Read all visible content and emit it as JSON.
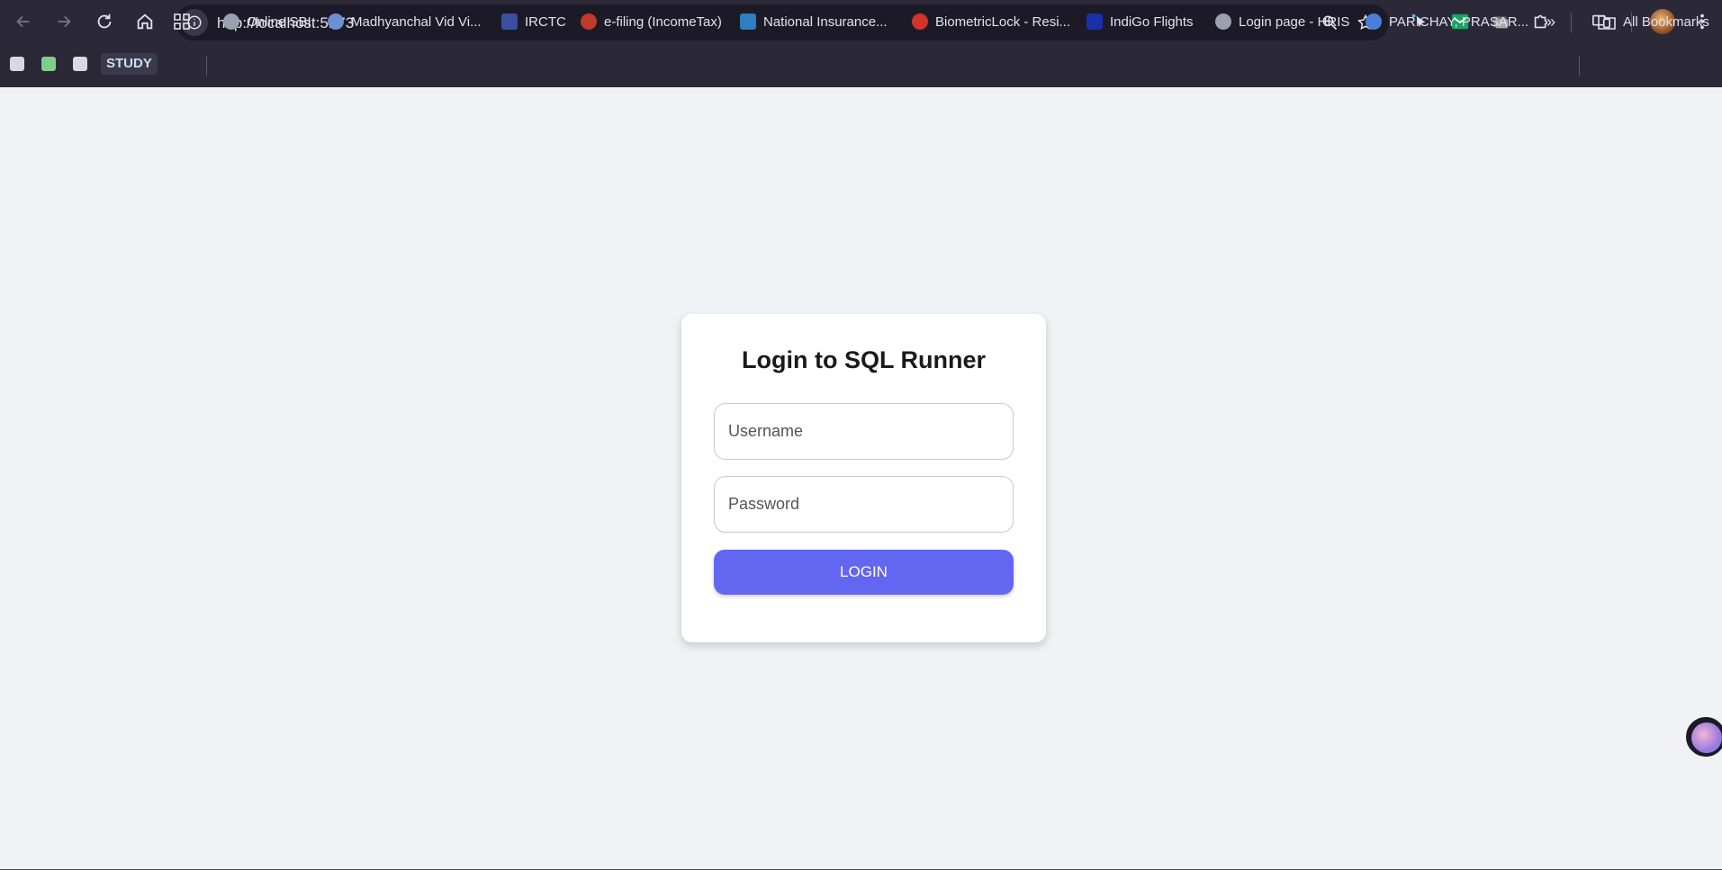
{
  "browser": {
    "url": "http://localhost:5173",
    "bookmarks": {
      "folder_label": "STUDY",
      "items": [
        {
          "label": "Online SBI",
          "color": "#9aa0ad"
        },
        {
          "label": "Madhyanchal Vid Vi...",
          "color": "#6c8fd6"
        },
        {
          "label": "IRCTC",
          "color": "#3b4ea0"
        },
        {
          "label": "e-filing (IncomeTax)",
          "color": "#c0392b"
        },
        {
          "label": "National Insurance...",
          "color": "#2e7fc0"
        },
        {
          "label": "BiometricLock - Resi...",
          "color": "#d4322c"
        },
        {
          "label": "IndiGo Flights",
          "color": "#1b2fa8"
        },
        {
          "label": "Login page - HRIS",
          "color": "#9aa0ad"
        },
        {
          "label": "PARICHAY, PRASAR...",
          "color": "#4a7fd8"
        }
      ],
      "overflow_label": "»",
      "all_bookmarks_label": "All Bookmarks"
    }
  },
  "login": {
    "title": "Login to SQL Runner",
    "username_placeholder": "Username",
    "password_placeholder": "Password",
    "button_label": "LOGIN"
  },
  "theme": {
    "accent": "#6366f1",
    "page_bg": "#f0f2f5",
    "chrome_bg": "#2b2838"
  }
}
